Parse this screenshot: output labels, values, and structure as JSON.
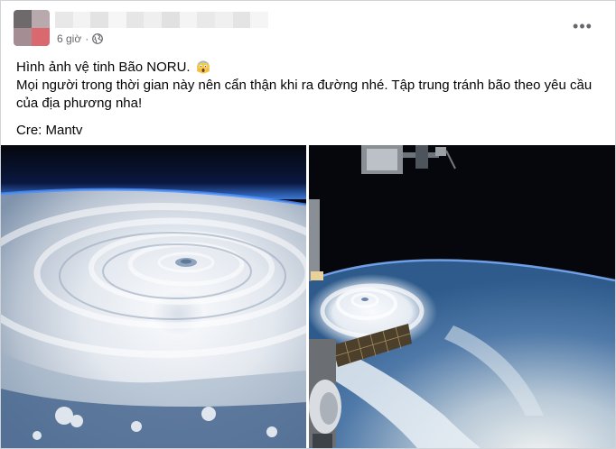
{
  "post": {
    "timestamp": "6 giờ",
    "privacy_icon": "globe-icon",
    "more_icon": "more-options-icon",
    "line1": "Hình ảnh vệ tinh Bão NORU.",
    "line1_emoji": "face-screaming-in-fear-emoji",
    "line2": "Mọi người trong thời gian này nên cẩn thận khi ra đường nhé. Tập trung tránh bão theo yêu cầu của địa phương nha!",
    "credit": "Cre: Mantv"
  },
  "colors": {
    "secondary_text": "#65676b",
    "primary_text": "#050505",
    "space": "#05070d",
    "ocean": "#2e5b8c"
  }
}
